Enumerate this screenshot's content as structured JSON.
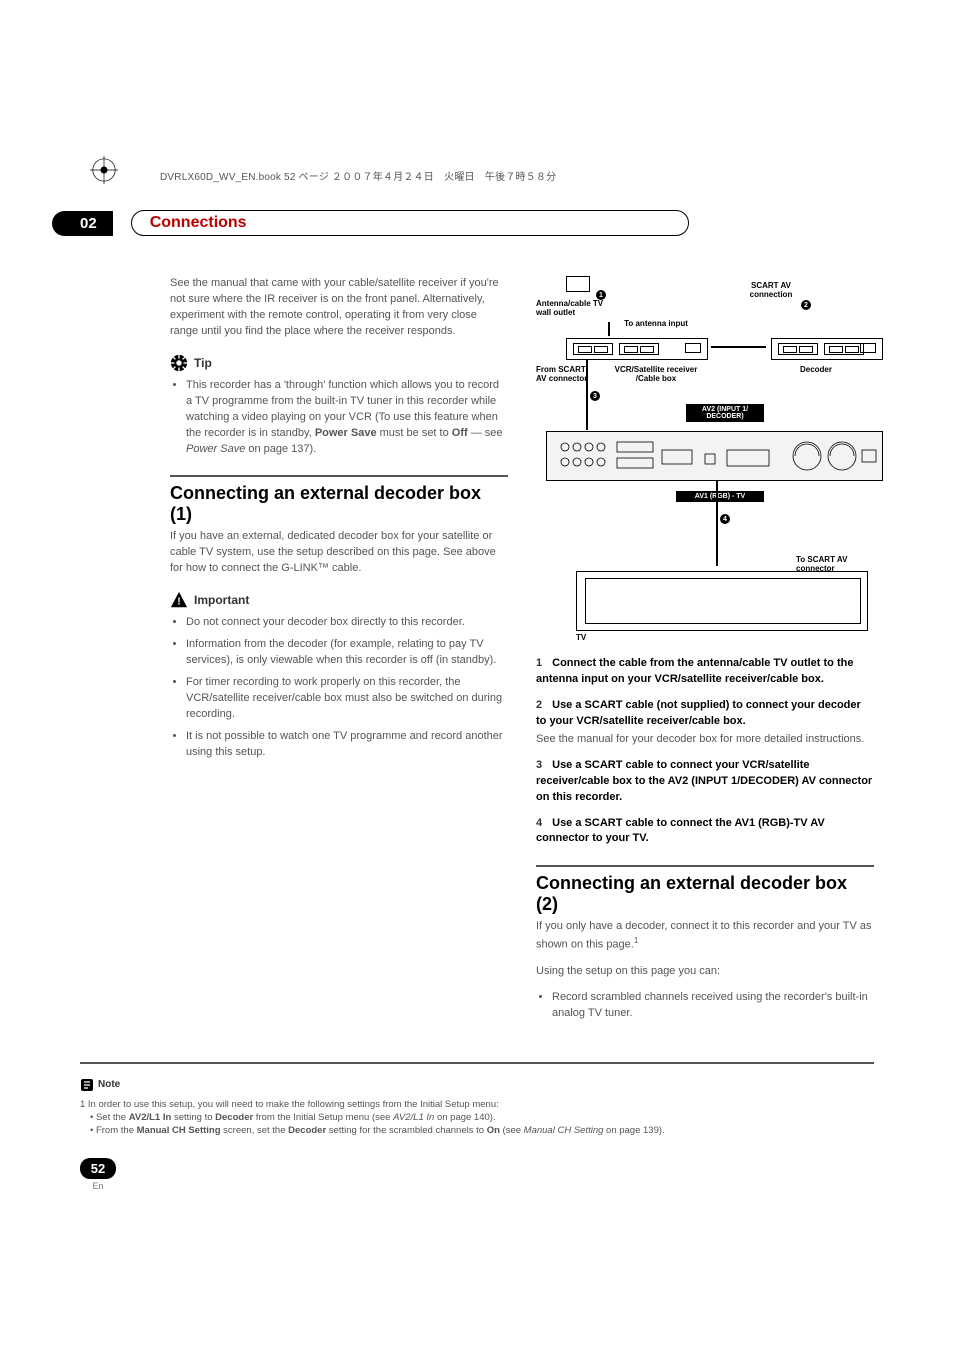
{
  "header": {
    "bookline": "DVRLX60D_WV_EN.book  52 ページ  ２００７年４月２４日　火曜日　午後７時５８分"
  },
  "chapter": {
    "number": "02",
    "title": "Connections"
  },
  "left": {
    "intro": "See the manual that came with your cable/satellite receiver if you're not sure where the IR receiver is on the front panel. Alternatively, experiment with the remote control, operating it from very close range until you find the place where the receiver responds.",
    "tip_label": "Tip",
    "tip_bullets": [
      "This recorder has a 'through' function which allows you to record a TV programme from the built-in TV tuner in this recorder while watching a video playing on your VCR (To use this feature when the recorder is in standby, Power Save must be set to Off — see Power Save on page 137)."
    ],
    "section1_title": "Connecting an external decoder box (1)",
    "section1_intro": "If you have an external, dedicated decoder box for your satellite or cable TV system, use the setup described on this page. See above for how to connect the G-LINK™ cable.",
    "important_label": "Important",
    "important_bullets": [
      "Do not connect your decoder box directly to this recorder.",
      "Information from the decoder (for example, relating to pay TV services), is only viewable when this recorder is off (in standby).",
      "For timer recording to work properly on this recorder, the VCR/satellite receiver/cable box must also be switched on during recording.",
      "It is not possible to watch one TV programme and record another using this setup."
    ]
  },
  "diagram": {
    "wall_outlet": "Antenna/cable TV wall outlet",
    "scart_av_connection": "SCART AV connection",
    "to_antenna_input": "To antenna input",
    "from_scart_av": "From SCART AV connector",
    "vcr_box": "VCR/Satellite receiver /Cable box",
    "decoder": "Decoder",
    "av2_badge": "AV2 (INPUT 1/ DECODER)",
    "av1_badge": "AV1 (RGB) - TV",
    "to_scart_av": "To SCART AV connector",
    "tv": "TV"
  },
  "right": {
    "step1": "Connect the cable from the antenna/cable TV outlet to the antenna input on your VCR/satellite receiver/cable box.",
    "step2a": "Use a SCART cable (not supplied) to connect your decoder to your VCR/satellite receiver/cable box.",
    "step2b": "See the manual for your decoder box for more detailed instructions.",
    "step3": "Use a SCART cable to connect your VCR/satellite receiver/cable box to the AV2 (INPUT 1/DECODER) AV connector on this recorder.",
    "step4": "Use a SCART cable to connect the AV1 (RGB)-TV AV connector to your TV.",
    "section2_title": "Connecting an external decoder box (2)",
    "section2_p1": "If you only have a decoder, connect it to this recorder and your TV as shown on this page.",
    "section2_p2": "Using the setup on this page you can:",
    "section2_bullet": "Record scrambled channels received using the recorder's built-in analog TV tuner."
  },
  "note": {
    "label": "Note",
    "line1": "1 In order to use this setup, you will need to make the following settings from the Initial Setup menu:",
    "b1_pre": "Set the ",
    "b1_bold1": "AV2/L1 In",
    "b1_mid": " setting to ",
    "b1_bold2": "Decoder",
    "b1_post": " from the Initial Setup menu (see AV2/L1 In on page 140).",
    "b2_pre": "From the ",
    "b2_bold1": "Manual CH Setting",
    "b2_mid1": " screen, set the ",
    "b2_bold2": "Decoder",
    "b2_mid2": " setting for the scrambled channels to ",
    "b2_bold3": "On",
    "b2_post": " (see Manual CH Setting on page 139)."
  },
  "page": {
    "number": "52",
    "lang": "En"
  }
}
